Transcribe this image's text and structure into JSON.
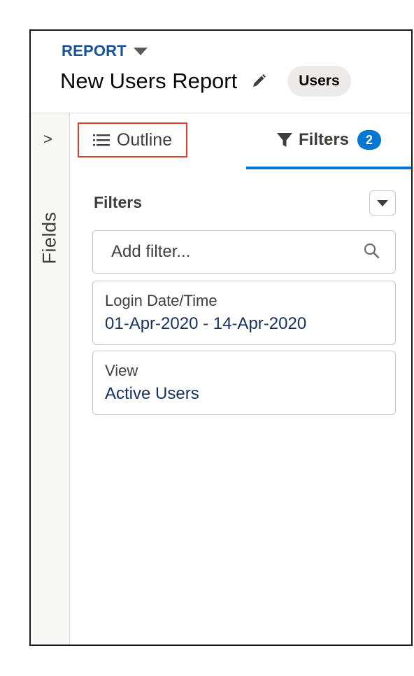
{
  "header": {
    "report_label": "REPORT",
    "title": "New Users Report",
    "report_type_badge": "Users"
  },
  "sidebar": {
    "fields_label": "Fields",
    "toggle_glyph": ">"
  },
  "tabs": [
    {
      "label": "Outline",
      "active": false,
      "icon": "list-icon"
    },
    {
      "label": "Filters",
      "active": true,
      "icon": "funnel-icon",
      "count": "2"
    }
  ],
  "filters_panel": {
    "heading": "Filters",
    "add_filter_placeholder": "Add filter...",
    "items": [
      {
        "label": "Login Date/Time",
        "value": "01-Apr-2020 - 14-Apr-2020"
      },
      {
        "label": "View",
        "value": "Active Users"
      }
    ]
  },
  "colors": {
    "brand_blue": "#0176d3",
    "link_navy": "#16325c",
    "report_label_blue": "#16539b",
    "highlight_red": "#e03e2d"
  }
}
